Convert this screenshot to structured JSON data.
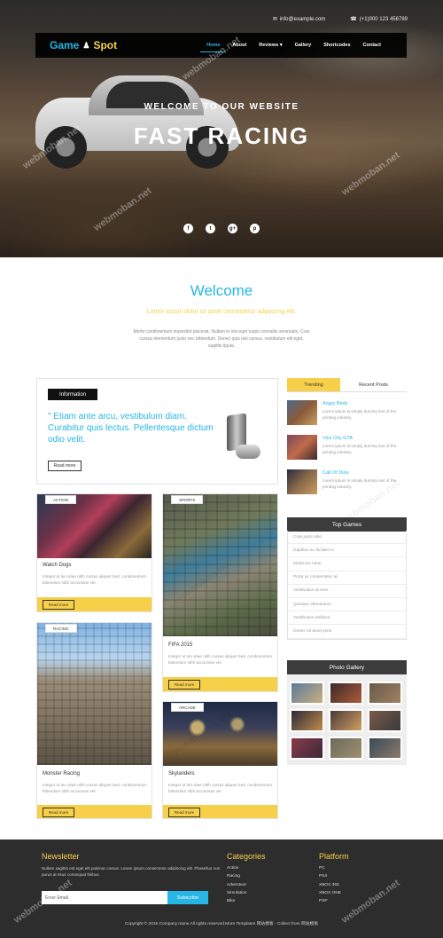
{
  "topbar": {
    "email": "info@example.com",
    "phone": "(+1)000 123 456789"
  },
  "logo": {
    "part1": "Game",
    "part2": "Spot"
  },
  "nav": [
    "Home",
    "About",
    "Reviews ▾",
    "Gallery",
    "Shortcodes",
    "Contact"
  ],
  "hero": {
    "subtitle": "WELCOME TO OUR WEBSITE",
    "title": "FAST RACING"
  },
  "socials": [
    "f",
    "t",
    "g+",
    "p"
  ],
  "welcome": {
    "title": "Welcome",
    "subtitle": "Lorem ipsum dolor sit amet consectetur adipiscing elit.",
    "text": "Morbi condimentum imperdiet placerat. Nullam in nisl eget turpis convallis venenatis. Cras cursus elementum justo nec bibendum. Donec quis nisi cursus, vestibulum elit eget, sagittis ligula."
  },
  "info": {
    "tag": "Information",
    "quote": "\" Etiam ante arcu, vestibulum diam. Curabitur quis lectus. Pellentesque dictum odio velit.",
    "button": "Read more"
  },
  "cards": [
    {
      "label": "ACTION",
      "name": "Watch Dogs",
      "desc": "Integer ut leo vitae nibh cursus aliquet Sed, condimentum bibendum nibh accumsan vel.",
      "more": "Read more"
    },
    {
      "label": "SPORTS",
      "name": "FIFA 2015",
      "desc": "Integer ut leo vitae nibh cursus aliquet Sed, condimentum bibendum nibh accumsan vel.",
      "more": "Read more"
    },
    {
      "label": "RACING",
      "name": "Monster Racing",
      "desc": "Integer ut leo vitae nibh cursus aliquet Sed, condimentum bibendum nibh accumsan vel.",
      "more": "Read more"
    },
    {
      "label": "ARCADE",
      "name": "Skylanders",
      "desc": "Integer ut leo vitae nibh cursus aliquet Sed, condimentum bibendum nibh accumsan vel.",
      "more": "Read more"
    }
  ],
  "tabs": {
    "trending": "Trending",
    "recent": "Recent Posts"
  },
  "posts": [
    {
      "title": "Angry Birds",
      "text": "Lorem ipsum is simply dummy text of the printing industry."
    },
    {
      "title": "Vice City GTA",
      "text": "Lorem ipsum is simply dummy text of the printing industry."
    },
    {
      "title": "Call Of Duty",
      "text": "Lorem ipsum is simply dummy text of the printing industry."
    }
  ],
  "topgames": {
    "title": "Top Games",
    "items": [
      "Cras justo odio",
      "Dapibus ac facilisis in",
      "Morbi leo risus",
      "Porta ac consectetur ac",
      "Vestibulum at eros",
      "Quisque elementum",
      "Vestibulum eleifend",
      "Donec sit amet justo"
    ]
  },
  "gallery": {
    "title": "Photo Gallery"
  },
  "footer": {
    "newsletter": "Newsletter",
    "newsletter_text": "Nullam sagittis est eget elit pulvinar cursus. Lorem ipsum consectetur adipiscing elit. Phasellus non purus at risus consequat finibus.",
    "email_placeholder": "Enter Email",
    "subscribe": "Subscribe",
    "categories_title": "Categories",
    "categories": [
      "Action",
      "Racing",
      "Adventure",
      "Simulation",
      "Bike"
    ],
    "platform_title": "Platform",
    "platforms": [
      "PC",
      "PS4",
      "XBOX 360",
      "XBOX ONE",
      "PSP"
    ],
    "copyright": "Copyright © 2015 Company name All rights reserved.More Templates 网站模板 - Collect from 网站模板"
  },
  "watermark": "webmoban.net"
}
